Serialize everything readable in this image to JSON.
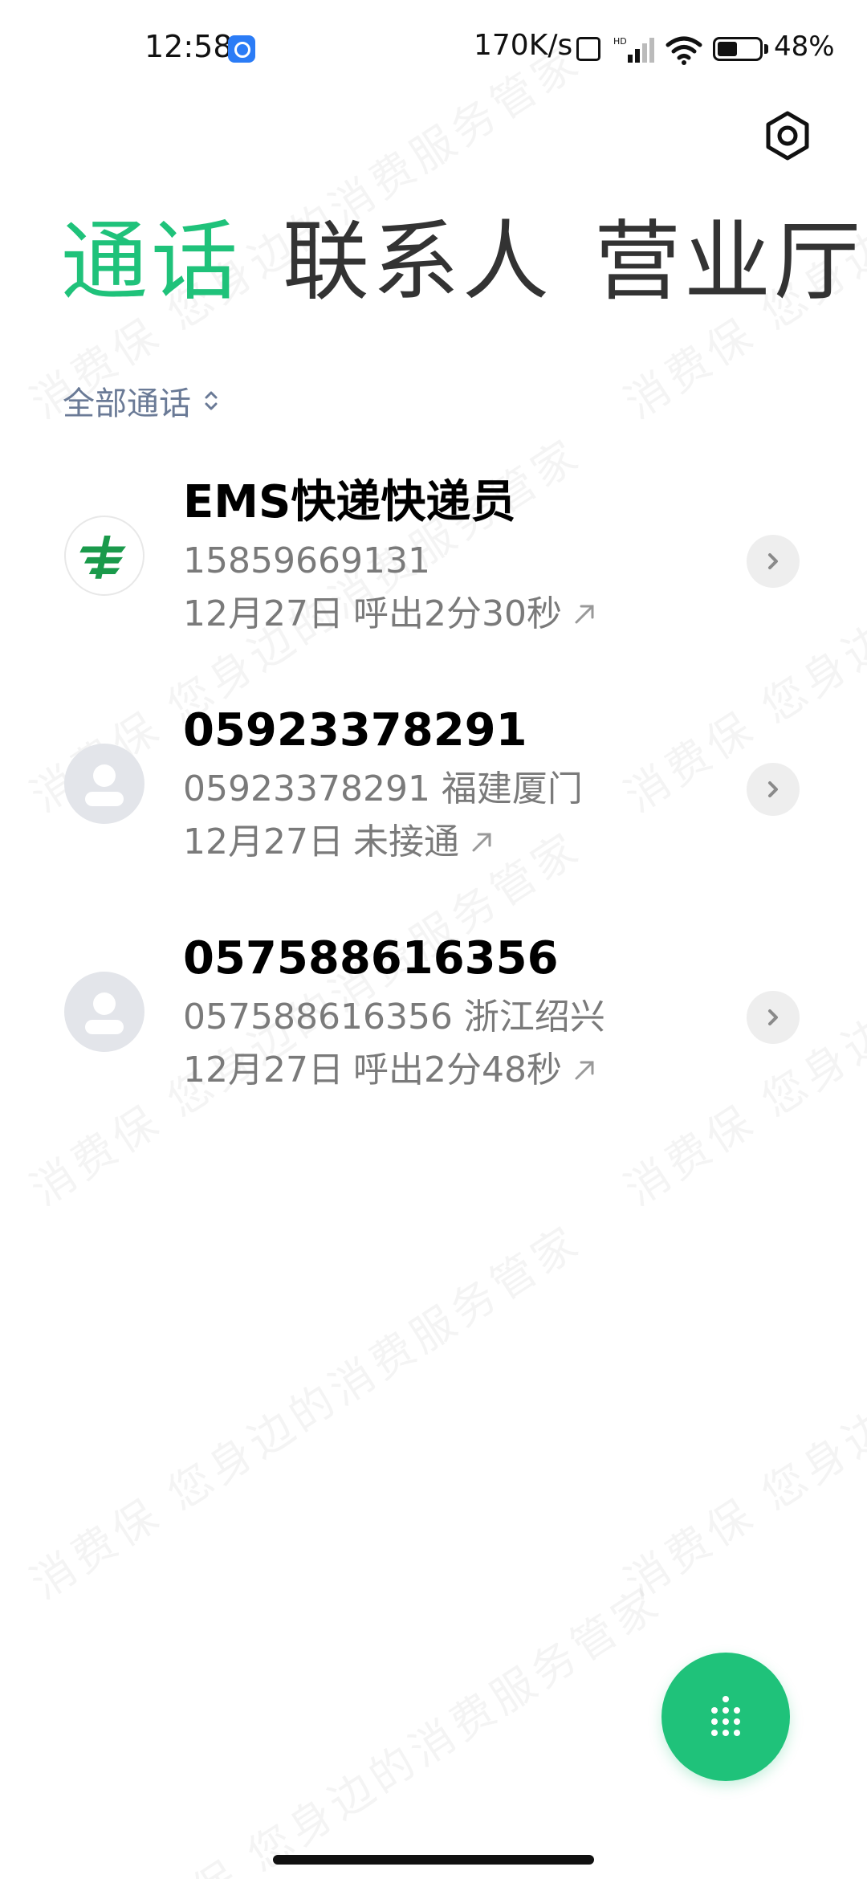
{
  "status_bar": {
    "time": "12:58",
    "net_speed": "170K/s",
    "battery_percent": "48%",
    "battery_level": 0.48,
    "icons": [
      "app-badge-icon",
      "nfc-icon",
      "hd-signal-icon",
      "wifi-icon",
      "battery-icon"
    ]
  },
  "header": {
    "settings_icon": "settings-hex-icon"
  },
  "tabs": [
    {
      "label": "通话",
      "active": true
    },
    {
      "label": "联系人",
      "active": false
    },
    {
      "label": "营业厅",
      "active": false
    }
  ],
  "filter": {
    "label": "全部通话",
    "icon": "sort-arrows-icon"
  },
  "calls": [
    {
      "name": "EMS快递快递员",
      "sub": "15859669131",
      "date": "12月27日",
      "status": "呼出2分30秒",
      "direction_icon": "outgoing-arrow-icon",
      "avatar": "ems-logo"
    },
    {
      "name": "05923378291",
      "sub": "05923378291 福建厦门",
      "date": "12月27日",
      "status": "未接通",
      "direction_icon": "outgoing-arrow-icon",
      "avatar": "default-person"
    },
    {
      "name": "057588616356",
      "sub": "057588616356 浙江绍兴",
      "date": "12月27日",
      "status": "呼出2分48秒",
      "direction_icon": "outgoing-arrow-icon",
      "avatar": "default-person"
    }
  ],
  "dial": {
    "icon": "dialpad-icon"
  },
  "watermark": {
    "text": "消费保 您身边的消费服务管家"
  },
  "colors": {
    "accent": "#1fc27a",
    "filter_text": "#6a7a96",
    "secondary_text": "#7a7a7a"
  }
}
